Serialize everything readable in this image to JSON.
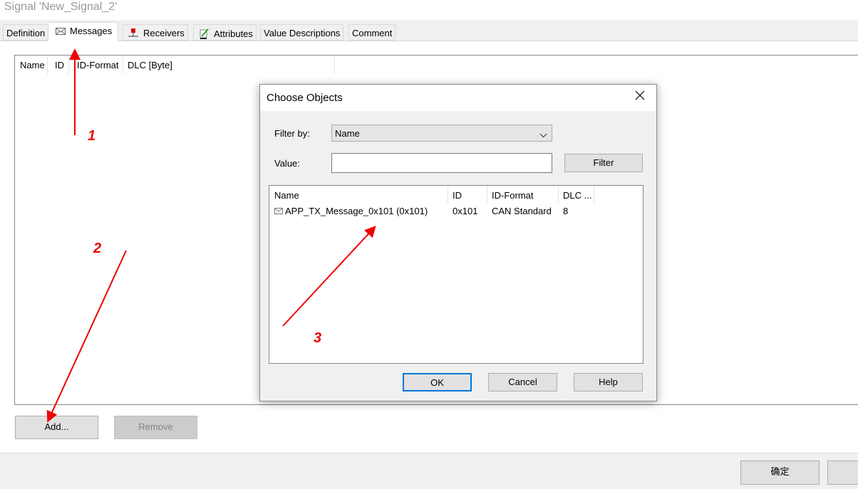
{
  "window": {
    "title": "Signal 'New_Signal_2'"
  },
  "tabs": [
    {
      "label": "Definition",
      "icon": ""
    },
    {
      "label": "Messages",
      "icon": "envelope-icon"
    },
    {
      "label": "Receivers",
      "icon": "node-icon"
    },
    {
      "label": "Attributes",
      "icon": "edit-icon"
    },
    {
      "label": "Value Descriptions",
      "icon": ""
    },
    {
      "label": "Comment",
      "icon": ""
    }
  ],
  "active_tab": "Messages",
  "messages_list": {
    "columns": [
      "Name",
      "ID",
      "ID-Format",
      "DLC [Byte]"
    ],
    "rows": []
  },
  "buttons": {
    "add": "Add...",
    "remove": "Remove",
    "ok": "确定"
  },
  "dialog": {
    "title": "Choose Objects",
    "filter_by_label": "Filter by:",
    "filter_by_value": "Name",
    "value_label": "Value:",
    "value_input": "",
    "filter_button": "Filter",
    "columns": [
      "Name",
      "ID",
      "ID-Format",
      "DLC ..."
    ],
    "rows": [
      {
        "name": "APP_TX_Message_0x101 (0x101)",
        "id": "0x101",
        "format": "CAN Standard",
        "dlc": "8"
      }
    ],
    "ok": "OK",
    "cancel": "Cancel",
    "help": "Help"
  },
  "annotations": [
    "1",
    "2",
    "3"
  ],
  "annotation_color": "#e00000"
}
